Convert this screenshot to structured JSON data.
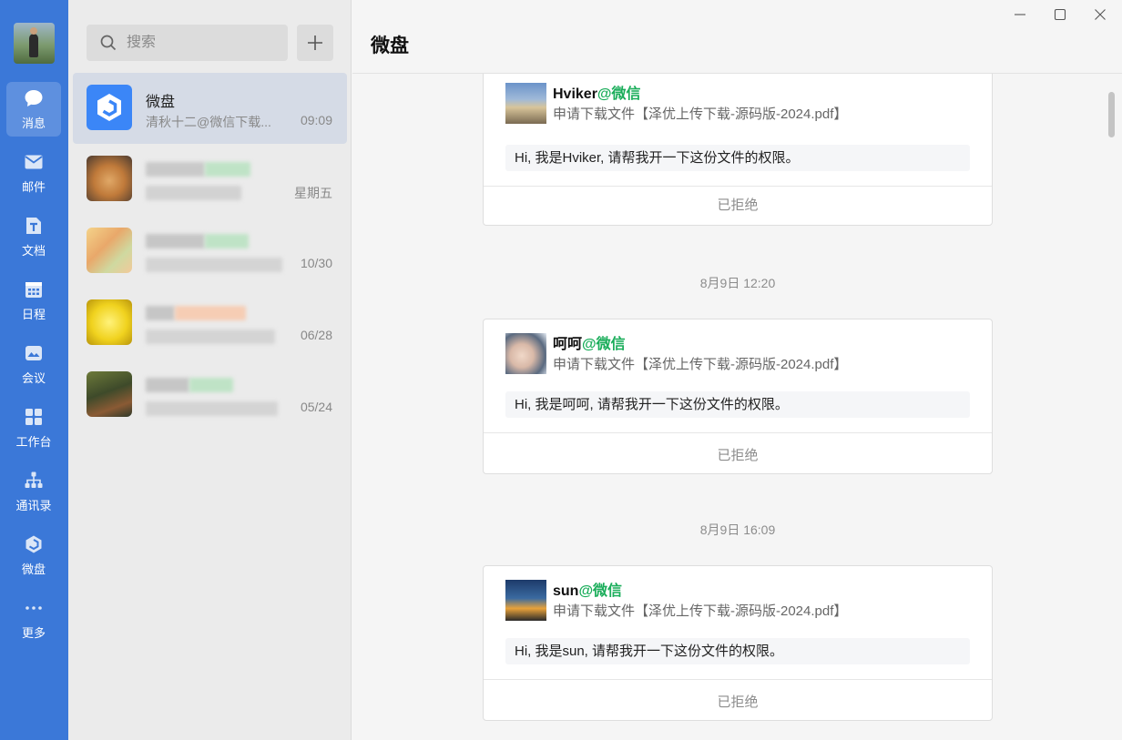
{
  "nav": {
    "items": [
      {
        "label": "消息",
        "icon": "chat-icon"
      },
      {
        "label": "邮件",
        "icon": "mail-icon"
      },
      {
        "label": "文档",
        "icon": "doc-icon"
      },
      {
        "label": "日程",
        "icon": "calendar-icon"
      },
      {
        "label": "会议",
        "icon": "meeting-icon"
      },
      {
        "label": "工作台",
        "icon": "apps-icon"
      },
      {
        "label": "通讯录",
        "icon": "contacts-icon"
      },
      {
        "label": "微盘",
        "icon": "drive-icon"
      },
      {
        "label": "更多",
        "icon": "more-icon"
      }
    ]
  },
  "search": {
    "placeholder": "搜索"
  },
  "conversations": [
    {
      "name": "微盘",
      "preview": "清秋十二@微信下载...",
      "time": "09:09"
    },
    {
      "name": "",
      "preview": "",
      "time": "星期五"
    },
    {
      "name": "",
      "preview": "",
      "time": "10/30"
    },
    {
      "name": "",
      "preview": "",
      "time": "06/28"
    },
    {
      "name": "",
      "preview": "",
      "time": "05/24"
    }
  ],
  "main": {
    "title": "微盘",
    "requests": [
      {
        "user": "Hviker",
        "source": "@微信",
        "file_line": "申请下载文件【泽优上传下载-源码版-2024.pdf】",
        "message": "Hi, 我是Hviker, 请帮我开一下这份文件的权限。",
        "status": "已拒绝"
      },
      {
        "timestamp": "8月9日 12:20",
        "user": "呵呵",
        "source": "@微信",
        "file_line": "申请下载文件【泽优上传下载-源码版-2024.pdf】",
        "message": "Hi, 我是呵呵, 请帮我开一下这份文件的权限。",
        "status": "已拒绝"
      },
      {
        "timestamp": "8月9日 16:09",
        "user": "sun",
        "source": "@微信",
        "file_line": "申请下载文件【泽优上传下载-源码版-2024.pdf】",
        "message": "Hi, 我是sun, 请帮我开一下这份文件的权限。",
        "status": "已拒绝"
      }
    ]
  },
  "colors": {
    "rail": "#3b78d8",
    "accent_green": "#1aad5a"
  }
}
